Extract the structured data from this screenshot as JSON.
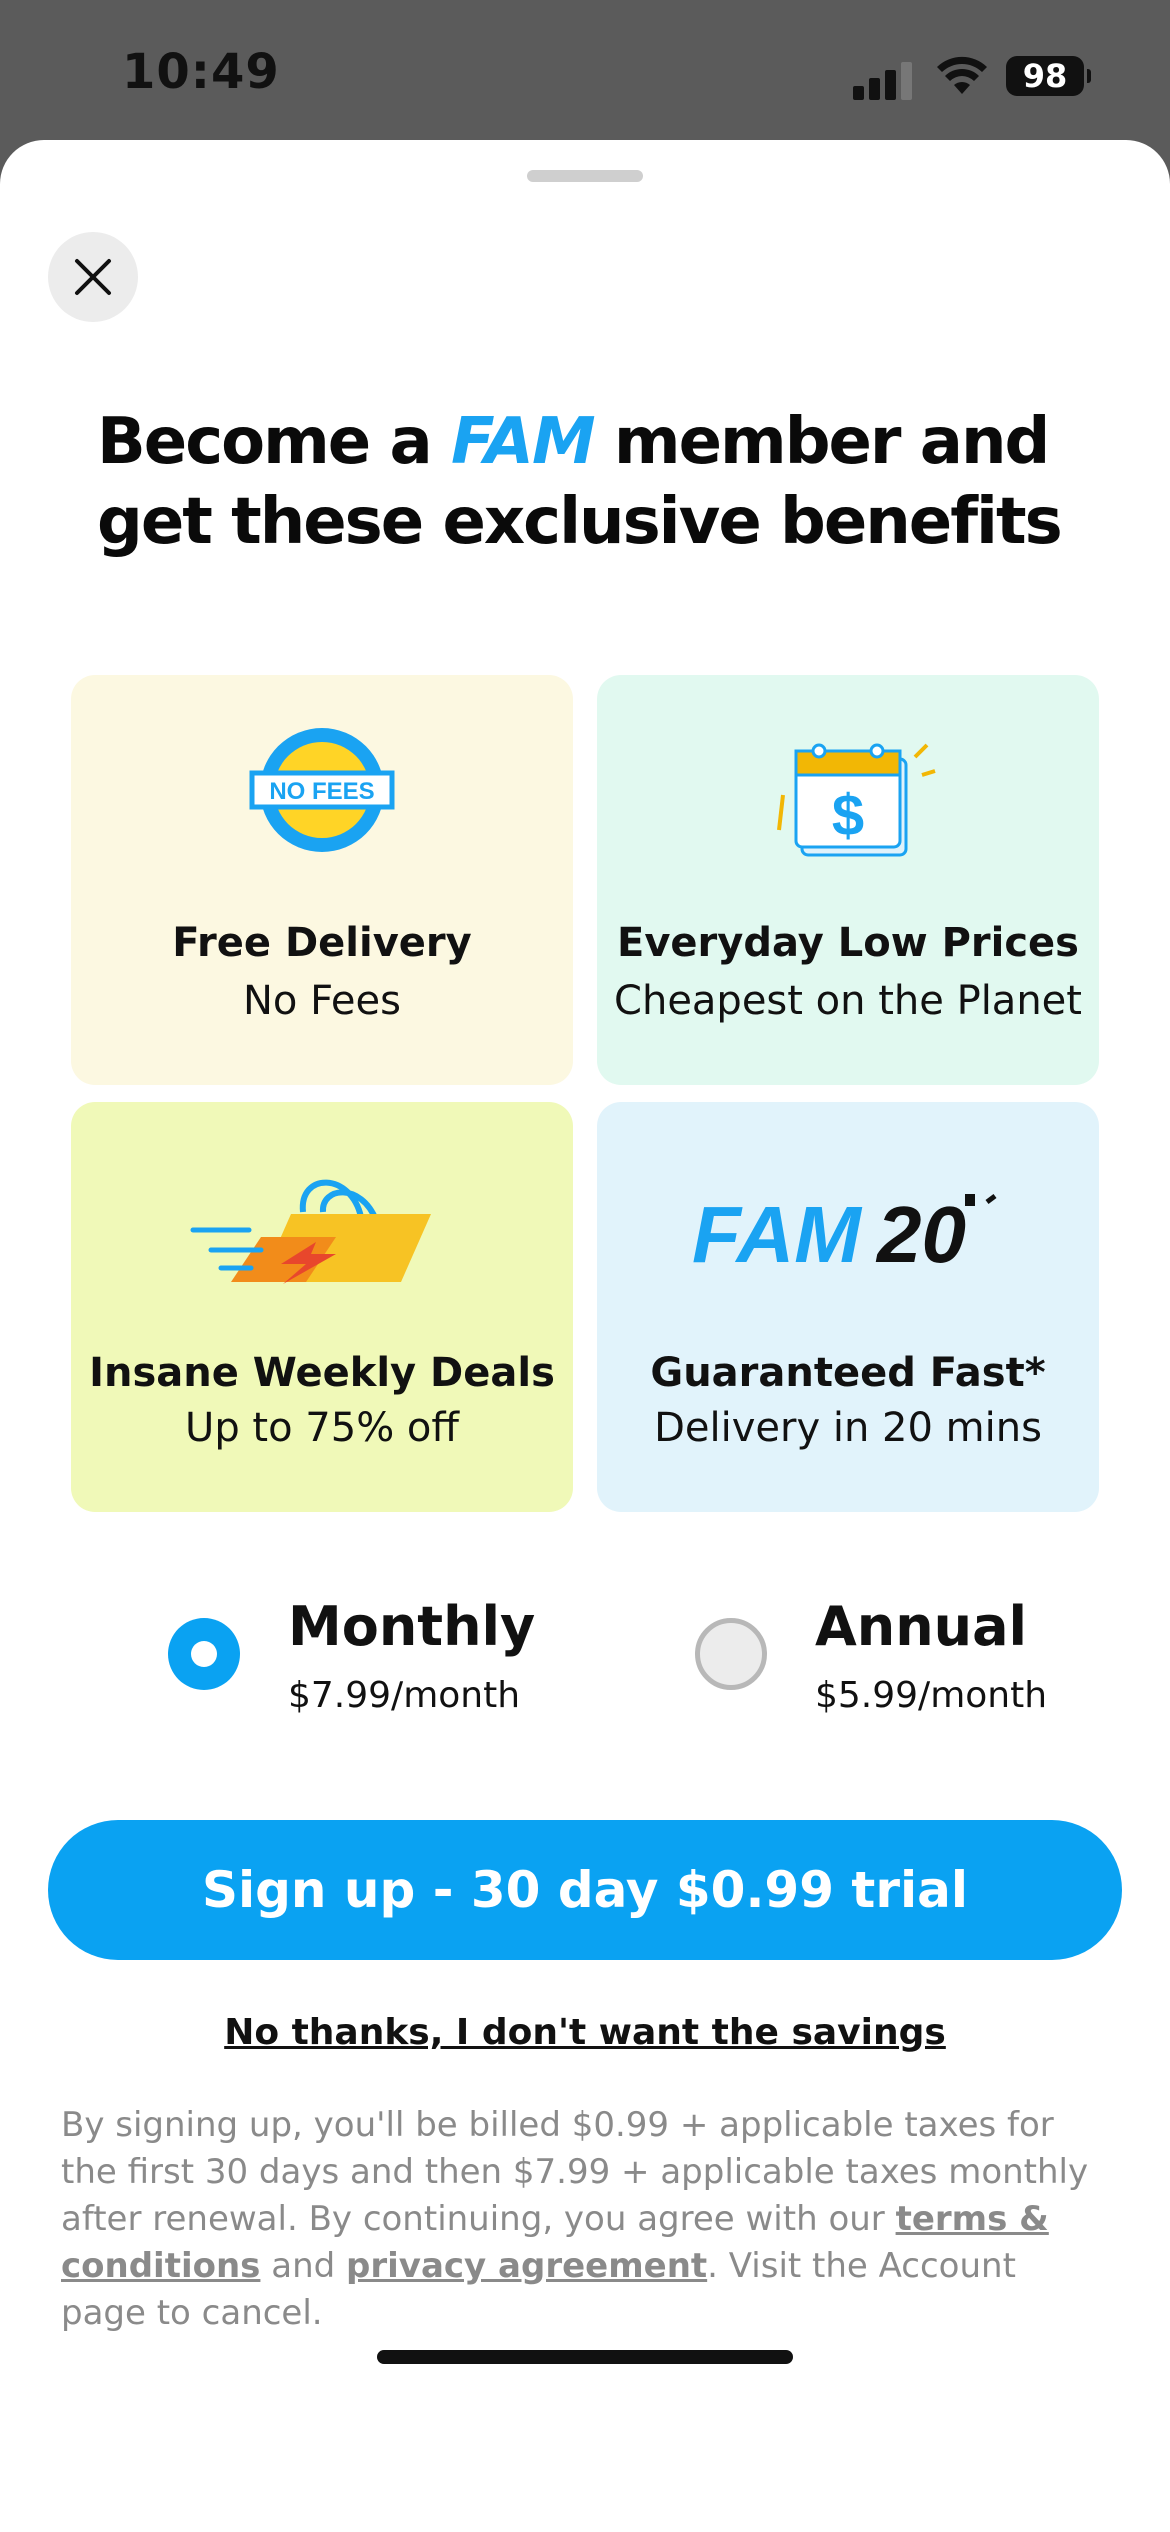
{
  "status_bar": {
    "time": "10:49",
    "battery": "98"
  },
  "headline": {
    "part1": "Become a ",
    "brand": "FAM",
    "part2": " member and get these exclusive benefits"
  },
  "benefits": [
    {
      "icon": "no-fees-icon",
      "icon_text": "NO FEES",
      "title": "Free Delivery",
      "subtitle": "No Fees"
    },
    {
      "icon": "price-calendar-icon",
      "icon_text": "$",
      "title": "Everyday Low Prices",
      "subtitle": "Cheapest on the Planet"
    },
    {
      "icon": "shopping-bag-speed-icon",
      "title": "Insane Weekly Deals",
      "subtitle": "Up to 75% off"
    },
    {
      "icon": "fam20-logo-icon",
      "logo_a": "FAM",
      "logo_b": "20",
      "title": "Guaranteed Fast*",
      "subtitle": "Delivery in 20 mins"
    }
  ],
  "plans": [
    {
      "label": "Monthly",
      "price": "$7.99/month",
      "selected": true
    },
    {
      "label": "Annual",
      "price": "$5.99/month",
      "selected": false
    }
  ],
  "cta": {
    "label": "Sign up - 30 day $0.99 trial"
  },
  "decline": {
    "label": "No thanks, I don't want the savings"
  },
  "legal": {
    "text1": "By signing up, you'll be billed $0.99 + applicable taxes for the first 30 days and then $7.99 + applicable taxes monthly after renewal. By continuing, you agree with our ",
    "terms_link": "terms & conditions",
    "text2": " and ",
    "privacy_link": "privacy agreement",
    "text3": ". Visit the Account page to cancel."
  },
  "colors": {
    "accent": "#0aa2f2",
    "brand": "#1aa3f2",
    "card_yellow": "#fcf8e1",
    "card_mint": "#e1f9f0",
    "card_lime": "#f0f9b8",
    "card_sky": "#e1f3fb"
  }
}
